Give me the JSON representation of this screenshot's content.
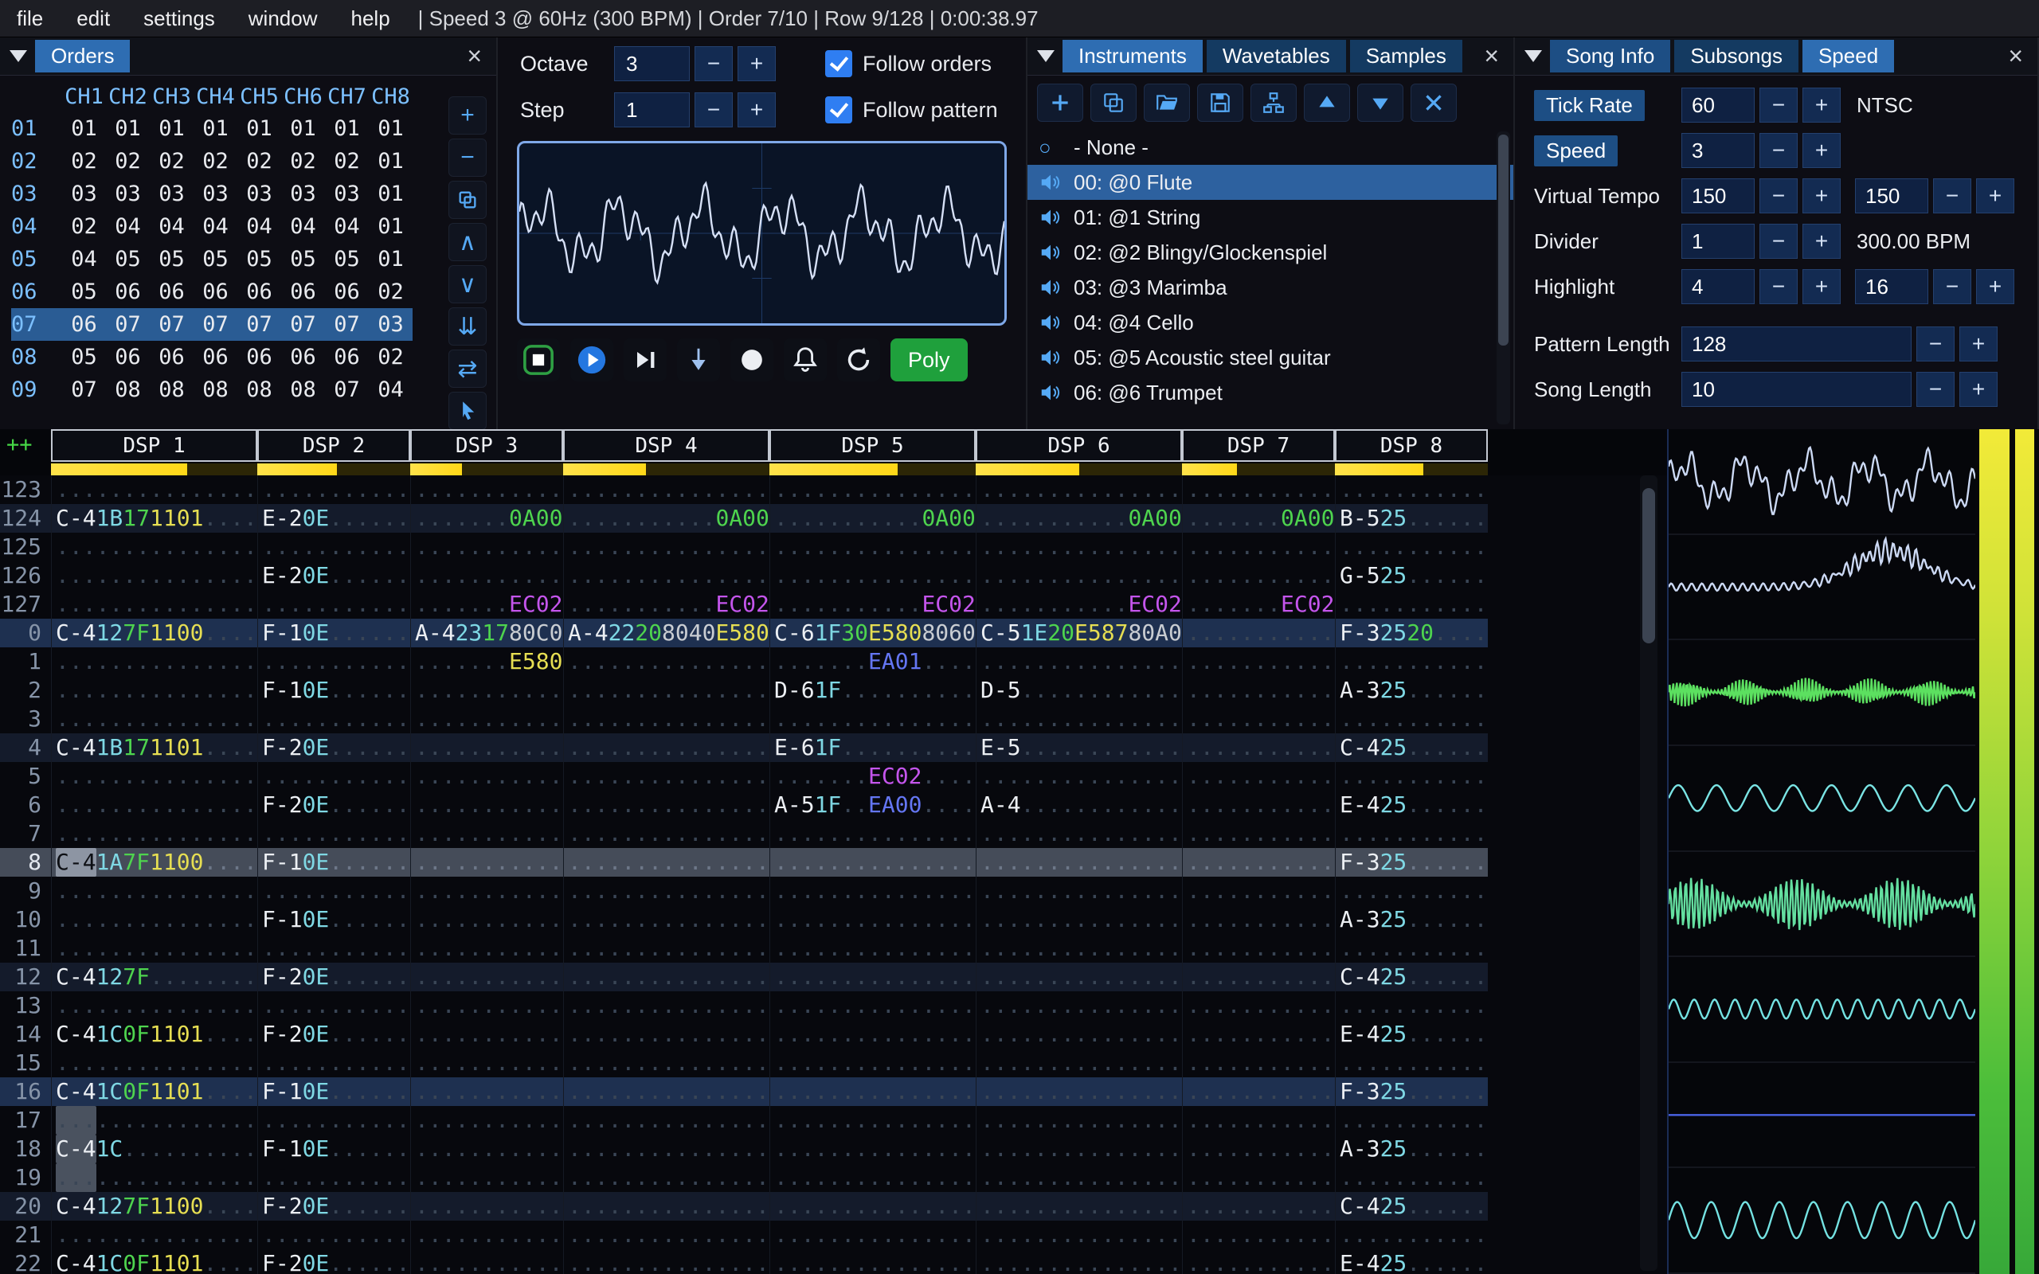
{
  "menu": {
    "items": [
      "file",
      "edit",
      "settings",
      "window",
      "help"
    ],
    "status": "| Speed 3 @ 60Hz (300 BPM) | Order 7/10 | Row 9/128 | 0:00:38.97"
  },
  "icons": {
    "close": "×",
    "none_radio": "○"
  },
  "orders": {
    "title": "Orders",
    "channels": [
      "CH1",
      "CH2",
      "CH3",
      "CH4",
      "CH5",
      "CH6",
      "CH7",
      "CH8"
    ],
    "current_row": "07",
    "rows": [
      {
        "label": "01",
        "values": [
          "01",
          "01",
          "01",
          "01",
          "01",
          "01",
          "01",
          "01"
        ]
      },
      {
        "label": "02",
        "values": [
          "02",
          "02",
          "02",
          "02",
          "02",
          "02",
          "02",
          "01"
        ]
      },
      {
        "label": "03",
        "values": [
          "03",
          "03",
          "03",
          "03",
          "03",
          "03",
          "03",
          "01"
        ]
      },
      {
        "label": "04",
        "values": [
          "02",
          "04",
          "04",
          "04",
          "04",
          "04",
          "04",
          "01"
        ]
      },
      {
        "label": "05",
        "values": [
          "04",
          "05",
          "05",
          "05",
          "05",
          "05",
          "05",
          "01"
        ]
      },
      {
        "label": "06",
        "values": [
          "05",
          "06",
          "06",
          "06",
          "06",
          "06",
          "06",
          "02"
        ]
      },
      {
        "label": "07",
        "values": [
          "06",
          "07",
          "07",
          "07",
          "07",
          "07",
          "07",
          "03"
        ]
      },
      {
        "label": "08",
        "values": [
          "05",
          "06",
          "06",
          "06",
          "06",
          "06",
          "06",
          "02"
        ]
      },
      {
        "label": "09",
        "values": [
          "07",
          "08",
          "08",
          "08",
          "08",
          "08",
          "07",
          "04"
        ]
      }
    ],
    "buttons": [
      {
        "name": "add-order-button",
        "glyph": "+",
        "kind": "text"
      },
      {
        "name": "remove-order-button",
        "glyph": "−",
        "kind": "text"
      },
      {
        "name": "duplicate-order-button",
        "kind": "svg-duplicate"
      },
      {
        "name": "move-order-up-button",
        "glyph": "∧",
        "kind": "text"
      },
      {
        "name": "move-order-down-button",
        "glyph": "∨",
        "kind": "text"
      },
      {
        "name": "duplicate-order-end-button",
        "glyph": "⇊",
        "kind": "text"
      },
      {
        "name": "order-change-mode-button",
        "glyph": "⇄",
        "kind": "text"
      },
      {
        "name": "order-edit-pointer-button",
        "kind": "svg-pointer"
      }
    ]
  },
  "controls": {
    "octave_label": "Octave",
    "octave_value": "3",
    "step_label": "Step",
    "step_value": "1",
    "follow_orders_label": "Follow orders",
    "follow_pattern_label": "Follow pattern",
    "follow_orders_checked": true,
    "follow_pattern_checked": true,
    "poly_label": "Poly",
    "main_scope": {
      "kind": "noise",
      "freq": 6,
      "amp": 0.6,
      "color": "#d6e0f6"
    }
  },
  "instruments": {
    "tabs": [
      {
        "label": "Instruments",
        "tone": "active"
      },
      {
        "label": "Wavetables",
        "tone": "off"
      },
      {
        "label": "Samples",
        "tone": "off"
      }
    ],
    "none_item": "- None -",
    "selected_index": 0,
    "items": [
      "00: @0 Flute",
      "01: @1 String",
      "02: @2 Blingy/Glockenspiel",
      "03: @3 Marimba",
      "04: @4 Cello",
      "05: @5 Acoustic steel guitar",
      "06: @6 Trumpet"
    ]
  },
  "song": {
    "tabs": [
      {
        "label": "Song Info",
        "tone": "mid"
      },
      {
        "label": "Subsongs",
        "tone": "off"
      },
      {
        "label": "Speed",
        "tone": "active"
      }
    ],
    "fields": {
      "tick_rate_label": "Tick Rate",
      "tick_rate": "60",
      "tick_rate_mode": "NTSC",
      "speed_label": "Speed",
      "speed": "3",
      "virtual_tempo_label": "Virtual Tempo",
      "virtual_tempo_num": "150",
      "virtual_tempo_den": "150",
      "divider_label": "Divider",
      "divider": "1",
      "bpm": "300.00 BPM",
      "highlight_label": "Highlight",
      "highlight_first": "4",
      "highlight_second": "16",
      "pattern_length_label": "Pattern Length",
      "pattern_length": "128",
      "song_length_label": "Song Length",
      "song_length": "10"
    }
  },
  "pattern": {
    "corner": "++",
    "channels": [
      {
        "name": "DSP 1",
        "segs": 5,
        "meter": 0.66
      },
      {
        "name": "DSP 2",
        "segs": 4,
        "meter": 0.52
      },
      {
        "name": "DSP 3",
        "segs": 4,
        "meter": 0.34
      },
      {
        "name": "DSP 4",
        "segs": 5,
        "meter": 0.4
      },
      {
        "name": "DSP 5",
        "segs": 5,
        "meter": 0.62
      },
      {
        "name": "DSP 6",
        "segs": 5,
        "meter": 0.5
      },
      {
        "name": "DSP 7",
        "segs": 4,
        "meter": 0.36
      },
      {
        "name": "DSP 8",
        "segs": 4,
        "meter": 0.58
      }
    ],
    "rows": [
      {
        "n": "123",
        "c": {}
      },
      {
        "n": "124",
        "h": 1,
        "c": {
          "0": [
            "C-4",
            "1B",
            "17",
            "1101",
            ""
          ],
          "1": [
            "E-2",
            "0E",
            "",
            ""
          ],
          "2": [
            "",
            "",
            "",
            "0A00"
          ],
          "3": [
            "",
            "",
            "",
            "",
            "0A00"
          ],
          "4": [
            "",
            "",
            "",
            "",
            "0A00"
          ],
          "5": [
            "",
            "",
            "",
            "",
            "0A00"
          ],
          "6": [
            "",
            "",
            "",
            "0A00"
          ],
          "7": [
            "B-5",
            "25",
            "",
            ""
          ]
        }
      },
      {
        "n": "125",
        "c": {}
      },
      {
        "n": "126",
        "c": {
          "1": [
            "E-2",
            "0E",
            "",
            ""
          ],
          "7": [
            "G-5",
            "25",
            "",
            ""
          ]
        }
      },
      {
        "n": "127",
        "c": {
          "2": [
            "",
            "",
            "",
            "EC02"
          ],
          "3": [
            "",
            "",
            "",
            "",
            "EC02"
          ],
          "4": [
            "",
            "",
            "",
            "",
            "EC02"
          ],
          "5": [
            "",
            "",
            "",
            "",
            "EC02"
          ],
          "6": [
            "",
            "",
            "",
            "EC02"
          ]
        }
      },
      {
        "n": "0",
        "h": 2,
        "c": {
          "0": [
            "C-4",
            "12",
            "7F",
            "1100",
            ""
          ],
          "1": [
            "F-1",
            "0E",
            "",
            ""
          ],
          "2": [
            "A-4",
            "23",
            "17",
            "80C0"
          ],
          "3": [
            "A-4",
            "22",
            "20",
            "8040",
            "E580"
          ],
          "4": [
            "C-6",
            "1F",
            "30",
            "E580",
            "8060"
          ],
          "5": [
            "C-5",
            "1E",
            "20",
            "E587",
            "80A0"
          ],
          "7": [
            "F-3",
            "25",
            "20",
            ""
          ]
        }
      },
      {
        "n": "1",
        "c": {
          "2": [
            "",
            "",
            "",
            "E580"
          ],
          "4": [
            "",
            "",
            "",
            "EA01",
            ""
          ]
        }
      },
      {
        "n": "2",
        "c": {
          "1": [
            "F-1",
            "0E",
            "",
            ""
          ],
          "4": [
            "D-6",
            "1F",
            "",
            "",
            ""
          ],
          "5": [
            "D-5",
            "",
            "",
            "",
            ""
          ],
          "7": [
            "A-3",
            "25",
            "",
            ""
          ]
        }
      },
      {
        "n": "3",
        "c": {}
      },
      {
        "n": "4",
        "h": 1,
        "c": {
          "0": [
            "C-4",
            "1B",
            "17",
            "1101",
            ""
          ],
          "1": [
            "F-2",
            "0E",
            "",
            ""
          ],
          "4": [
            "E-6",
            "1F",
            "",
            "",
            ""
          ],
          "5": [
            "E-5",
            "",
            "",
            "",
            ""
          ],
          "7": [
            "C-4",
            "25",
            "",
            ""
          ]
        }
      },
      {
        "n": "5",
        "c": {
          "4": [
            "",
            "",
            "",
            "EC02",
            ""
          ]
        }
      },
      {
        "n": "6",
        "c": {
          "1": [
            "F-2",
            "0E",
            "",
            ""
          ],
          "4": [
            "A-5",
            "1F",
            "",
            "EA00",
            ""
          ],
          "5": [
            "A-4",
            "",
            "",
            "",
            ""
          ],
          "7": [
            "E-4",
            "25",
            "",
            ""
          ]
        }
      },
      {
        "n": "7",
        "c": {}
      },
      {
        "n": "8",
        "h": 1,
        "play": true,
        "cur": true,
        "c": {
          "0": [
            "C-4",
            "1A",
            "7F",
            "1100",
            ""
          ],
          "1": [
            "F-1",
            "0E",
            "",
            ""
          ],
          "7": [
            "F-3",
            "25",
            "",
            ""
          ]
        }
      },
      {
        "n": "9",
        "c": {}
      },
      {
        "n": "10",
        "c": {
          "1": [
            "F-1",
            "0E",
            "",
            ""
          ],
          "7": [
            "A-3",
            "25",
            "",
            ""
          ]
        }
      },
      {
        "n": "11",
        "c": {}
      },
      {
        "n": "12",
        "h": 1,
        "c": {
          "0": [
            "C-4",
            "12",
            "7F",
            "",
            ""
          ],
          "1": [
            "F-2",
            "0E",
            "",
            ""
          ],
          "7": [
            "C-4",
            "25",
            "",
            ""
          ]
        }
      },
      {
        "n": "13",
        "c": {}
      },
      {
        "n": "14",
        "c": {
          "0": [
            "C-4",
            "1C",
            "0F",
            "1101",
            ""
          ],
          "1": [
            "F-2",
            "0E",
            "",
            ""
          ],
          "7": [
            "E-4",
            "25",
            "",
            ""
          ]
        }
      },
      {
        "n": "15",
        "c": {}
      },
      {
        "n": "16",
        "h": 2,
        "c": {
          "0": [
            "C-4",
            "1C",
            "0F",
            "1101",
            ""
          ],
          "1": [
            "F-1",
            "0E",
            "",
            ""
          ],
          "7": [
            "F-3",
            "25",
            "",
            ""
          ]
        }
      },
      {
        "n": "17",
        "sel": true,
        "c": {}
      },
      {
        "n": "18",
        "sel": true,
        "c": {
          "0": [
            "C-4",
            "1C",
            "",
            "",
            ""
          ],
          "1": [
            "F-1",
            "0E",
            "",
            ""
          ],
          "7": [
            "A-3",
            "25",
            "",
            ""
          ]
        }
      },
      {
        "n": "19",
        "sel": true,
        "c": {}
      },
      {
        "n": "20",
        "h": 1,
        "c": {
          "0": [
            "C-4",
            "12",
            "7F",
            "1100",
            ""
          ],
          "1": [
            "F-2",
            "0E",
            "",
            ""
          ],
          "7": [
            "C-4",
            "25",
            "",
            ""
          ]
        }
      },
      {
        "n": "21",
        "c": {}
      },
      {
        "n": "22",
        "c": {
          "0": [
            "C-4",
            "1C",
            "0F",
            "1101",
            ""
          ],
          "1": [
            "F-2",
            "0E",
            "",
            ""
          ],
          "7": [
            "E-4",
            "25",
            "",
            ""
          ]
        }
      }
    ]
  },
  "scopes": [
    {
      "name": "channel-1",
      "kind": "noise",
      "freq": 5,
      "amp": 0.7,
      "color": "#ccd9f4"
    },
    {
      "name": "channel-2",
      "kind": "burst",
      "freq": 8,
      "amp": 0.95,
      "color": "#ccd9f4"
    },
    {
      "name": "channel-3",
      "kind": "dense",
      "freq": 88,
      "mod": 5,
      "amp": 0.3,
      "color": "#5ce060"
    },
    {
      "name": "channel-4",
      "kind": "sine",
      "freq": 8,
      "amp": 0.27,
      "color": "#7ae4e4"
    },
    {
      "name": "channel-5",
      "kind": "dense",
      "freq": 58,
      "mod": 3,
      "amp": 0.55,
      "color": "#64dfa0"
    },
    {
      "name": "channel-6",
      "kind": "sine",
      "freq": 15,
      "amp": 0.2,
      "color": "#74e2e2"
    },
    {
      "name": "channel-7",
      "kind": "flat",
      "freq": 1,
      "amp": 0.0,
      "color": "#4a63e6"
    },
    {
      "name": "channel-8",
      "kind": "sine",
      "freq": 9,
      "amp": 0.38,
      "color": "#74e2e2"
    }
  ],
  "colors": {
    "tab_active": "#2e6db2",
    "tab_mid": "#1d4e84",
    "tab_off": "#143a61",
    "icon_blue": "#55a9f5",
    "check_blue": "#2f7ef2",
    "poly_green": "#1fa03c",
    "stop_green": "#2ea043",
    "play_blue": "#2477e0",
    "scope_border": "#7fa8e8",
    "note": "#eceff3",
    "instrument": "#7fd8e4",
    "volume": "#4ed44e",
    "fx_green": "#4ed44e",
    "fx_purple": "#c455ec",
    "fx_yellow": "#e6de52",
    "fx_blue": "#6476f2",
    "fx_gray": "#c9cdd2",
    "dots": "#3a4656",
    "row_h1_bg": "#141b2b",
    "row_h2_bg": "#1e3050",
    "row_play_bg": "#454c59",
    "cursor_bg": "#8d95a3",
    "select_bg": "#4a525f",
    "order_cur_bg": "#2a5c94",
    "meter_yellow": "#ffd818",
    "meter_track": "#2c2606",
    "vu_top": "#f2ea38",
    "vu_bottom": "#37a839",
    "header_blue": "#7cc0ff"
  }
}
